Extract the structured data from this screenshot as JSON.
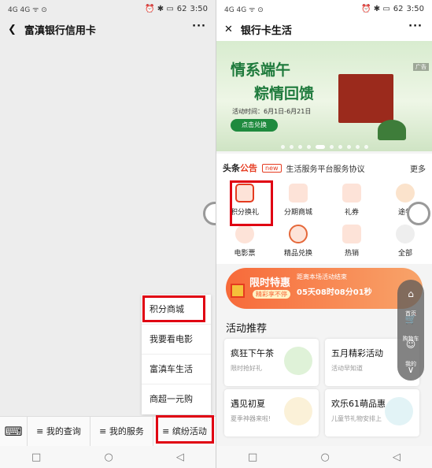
{
  "left": {
    "status": {
      "signal": "4G 4G ᯤ ⊙",
      "icons": "⏰ ✱ ▭",
      "battery": "62",
      "time": "3:50"
    },
    "title": "富滇银行信用卡",
    "more": "···",
    "popup_items": [
      "积分商城",
      "我要看电影",
      "富滇车生活",
      "商超一元购"
    ],
    "tabs": [
      "≡ 我的查询",
      "≡ 我的服务",
      "≡ 缤纷活动"
    ],
    "keyboard_icon": "keyboard-icon"
  },
  "nav": {
    "back": "◁",
    "home": "○",
    "recents": "□"
  },
  "right": {
    "status": {
      "signal": "4G 4G ᯤ ⊙",
      "icons": "⏰ ✱ ▭",
      "battery": "62",
      "time": "3:50"
    },
    "title": "银行卡生活",
    "more": "···",
    "banner": {
      "line1": "情系端午",
      "line2": "粽情回馈",
      "time": "活动时间：6月1日-6月21日",
      "button": "点击兑换",
      "ad": "广告"
    },
    "notice": {
      "logo_a": "头条",
      "logo_b": "公告",
      "badge": "new",
      "text": "生活服务平台服务协议",
      "more": "更多"
    },
    "grid": [
      "积分换礼",
      "分期商城",
      "礼券",
      "途牛",
      "电影票",
      "精品兑换",
      "热销",
      "全部"
    ],
    "promo": {
      "title": "限时特惠",
      "tag": "精彩享不停",
      "countdown_label": "距离本场活动结束",
      "countdown": "05天08时08分01秒"
    },
    "section_title": "活动推荐",
    "cards": [
      {
        "title": "疯狂下午茶",
        "sub": "限时抢好礼"
      },
      {
        "title": "五月精彩活动",
        "sub": "活动早知道"
      },
      {
        "title": "遇见初夏",
        "sub": "夏季神器来啦!"
      },
      {
        "title": "欢乐61萌品惠",
        "sub": "儿童节礼物安排上"
      }
    ],
    "floating_nav": [
      {
        "icon": "⌂",
        "label": "首页"
      },
      {
        "icon": "🛒",
        "label": "购物车"
      },
      {
        "icon": "☺",
        "label": "我的"
      },
      {
        "icon": "∨",
        "label": ""
      }
    ]
  }
}
